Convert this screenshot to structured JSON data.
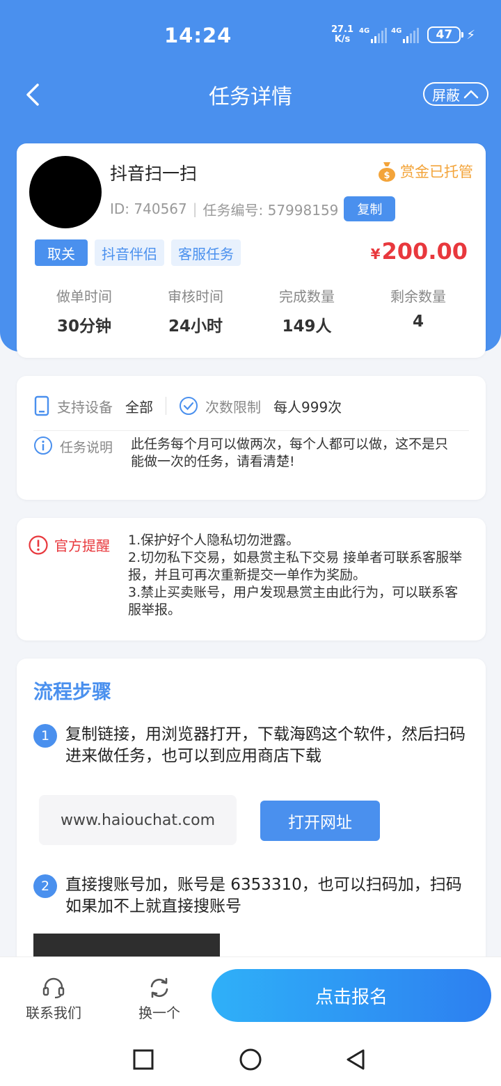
{
  "status_bar": {
    "time": "14:24",
    "speed_value": "27.1",
    "speed_unit": "K/s",
    "net1": "4G",
    "net2": "4G",
    "battery": "47"
  },
  "nav": {
    "title": "任务详情",
    "shield_label": "屏蔽"
  },
  "task": {
    "name": "抖音扫一扫",
    "escrow_label": "赏金已托管",
    "id_text": "ID: 740567",
    "task_no_text": "任务编号: 57998159",
    "copy_label": "复制",
    "tags": [
      "取关",
      "抖音伴侣",
      "客服任务"
    ],
    "price_currency": "¥",
    "price_value": "200.00",
    "stats": [
      {
        "label": "做单时间",
        "value": "30分钟"
      },
      {
        "label": "审核时间",
        "value": "24小时"
      },
      {
        "label": "完成数量",
        "value": "149人"
      },
      {
        "label": "剩余数量",
        "value": "4"
      }
    ]
  },
  "info": {
    "device_label": "支持设备",
    "device_value": "全部",
    "limit_label": "次数限制",
    "limit_value": "每人999次",
    "desc_label": "任务说明",
    "desc_text": "此任务每个月可以做两次，每个人都可以做，这不是只能做一次的任务，请看清楚!"
  },
  "notice": {
    "label": "官方提醒",
    "lines": [
      "1.保护好个人隐私切勿泄露。",
      "2.切勿私下交易，如悬赏主私下交易 接单者可联系客服举报，并且可再次重新提交一单作为奖励。",
      "3.禁止买卖账号，用户发现悬赏主由此行为，可以联系客服举报。"
    ]
  },
  "steps": {
    "title": "流程步骤",
    "items": [
      {
        "num": "1",
        "text": "复制链接，用浏览器打开，下载海鸥这个软件，然后扫码进来做任务，也可以到应用商店下载"
      },
      {
        "num": "2",
        "text": "直接搜账号加，账号是 6353310，也可以扫码加，扫码如果加不上就直接搜账号"
      }
    ],
    "url": "www.haiouchat.com",
    "open_label": "打开网址"
  },
  "bottom": {
    "contact_label": "联系我们",
    "switch_label": "换一个",
    "apply_label": "点击报名"
  },
  "colors": {
    "primary": "#4a90ee",
    "price": "#e8383d",
    "escrow": "#f3a43a"
  }
}
